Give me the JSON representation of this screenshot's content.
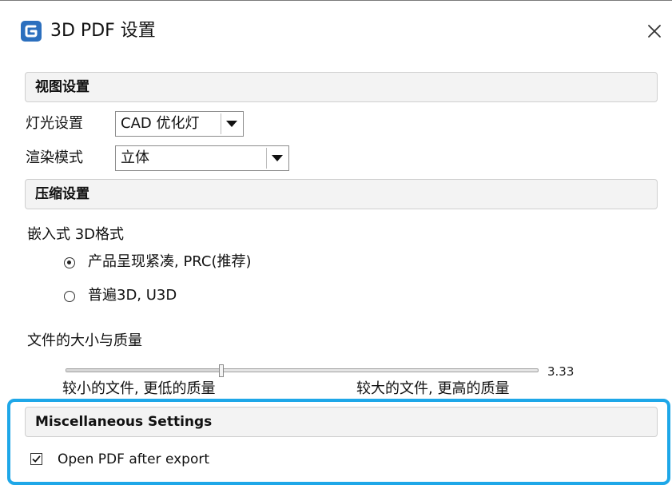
{
  "window": {
    "title": "3D PDF 设置",
    "icon": "app-logo-icon",
    "close_icon": "close-icon",
    "accent_color": "#2b6fbe"
  },
  "view_settings": {
    "header": "视图设置",
    "lighting_label": "灯光设置",
    "lighting_value": "CAD 优化灯",
    "render_label": "渲染模式",
    "render_value": "立体"
  },
  "compression": {
    "header": "压缩设置",
    "format_label": "嵌入式 3D格式",
    "options": [
      {
        "label": "产品呈现紧凑, PRC(推荐)",
        "checked": true
      },
      {
        "label": "普遍3D, U3D",
        "checked": false
      }
    ],
    "size_quality_label": "文件的大小与质量",
    "slider_value_text": "3.33",
    "slider_fraction": 0.33,
    "slider_min_label": "较小的文件, 更低的质量",
    "slider_max_label": "较大的文件, 更高的质量"
  },
  "misc": {
    "header": "Miscellaneous Settings",
    "open_pdf_label": "Open PDF after export",
    "open_pdf_checked": true,
    "highlight_color": "#1ea7e8"
  }
}
